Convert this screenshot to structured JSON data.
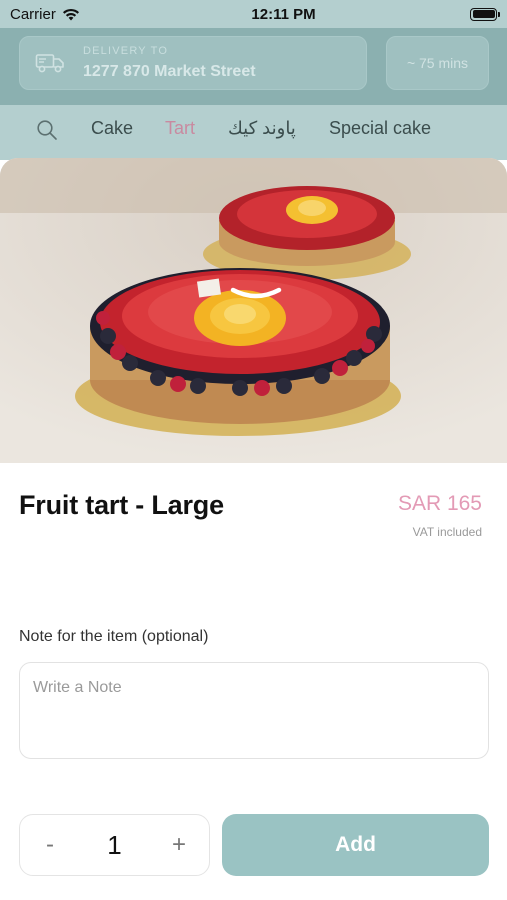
{
  "status_bar": {
    "carrier": "Carrier",
    "time": "12:11 PM"
  },
  "header": {
    "delivery_caption": "DELIVERY TO",
    "delivery_address": "1277 870 Market Street",
    "delivery_time": "~ 75 mins"
  },
  "categories": {
    "items": [
      "Cake",
      "Tart",
      "پاوند کیك",
      "Special cake"
    ],
    "active": "Tart"
  },
  "product": {
    "title": "Fruit tart - Large",
    "price": "SAR 165",
    "vat_note": "VAT included",
    "image_subject": "fruit tart with strawberries, berries and mango rose"
  },
  "note": {
    "label": "Note for the item (optional)",
    "placeholder": "Write a Note",
    "value": ""
  },
  "order": {
    "minus_label": "-",
    "quantity": "1",
    "plus_label": "+",
    "add_label": "Add"
  },
  "colors": {
    "accent_teal": "#9ac3c3",
    "price_pink": "#e39ab5",
    "active_category": "#c98aa0"
  },
  "icons": {
    "wifi": "wifi-icon",
    "battery": "battery-icon",
    "delivery": "delivery-truck-icon",
    "search": "search-icon",
    "handle": "sheet-handle-icon"
  }
}
